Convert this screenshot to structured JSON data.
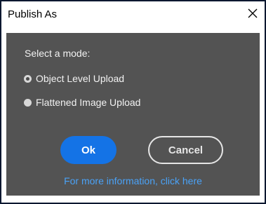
{
  "window": {
    "title": "Publish As",
    "close_icon": "close-icon"
  },
  "dialog": {
    "mode_label": "Select a mode:",
    "modes": [
      {
        "label": "Object Level Upload",
        "selected": true
      },
      {
        "label": "Flattened Image Upload",
        "selected": false
      }
    ],
    "ok_label": "Ok",
    "cancel_label": "Cancel",
    "info_link": "For more information, click here"
  },
  "colors": {
    "panel_bg": "#535353",
    "primary_button": "#1473e6",
    "link": "#4aa2f7",
    "window_border": "#0a1730"
  }
}
